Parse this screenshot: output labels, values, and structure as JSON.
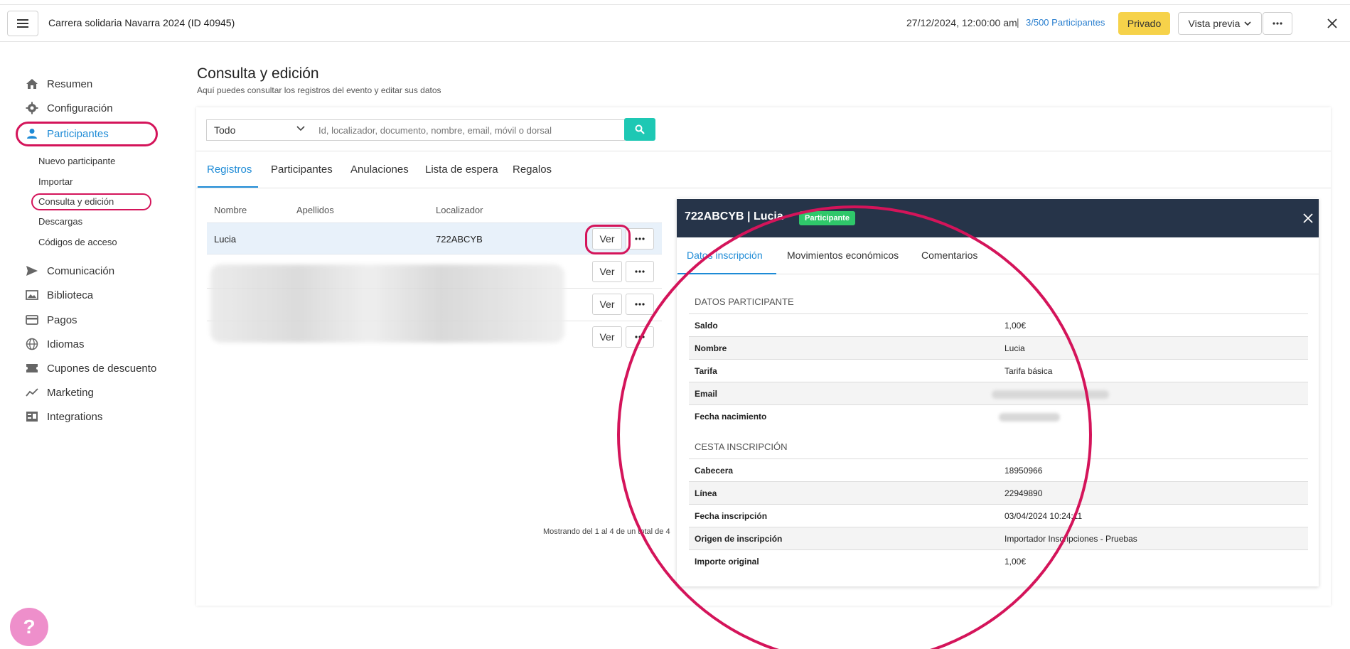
{
  "header": {
    "event_title": "Carrera solidaria Navarra 2024 (ID 40945)",
    "date": "27/12/2024, 12:00:00 am",
    "separator": "|",
    "participants_current": "3/500",
    "participants_label": "Participantes",
    "private_label": "Privado",
    "preview_label": "Vista previa"
  },
  "sidebar": {
    "items": [
      {
        "label": "Resumen",
        "icon": "home-icon"
      },
      {
        "label": "Configuración",
        "icon": "gear-icon"
      },
      {
        "label": "Participantes",
        "icon": "person-icon"
      },
      {
        "label": "Comunicación",
        "icon": "send-icon"
      },
      {
        "label": "Biblioteca",
        "icon": "images-icon"
      },
      {
        "label": "Pagos",
        "icon": "card-icon"
      },
      {
        "label": "Idiomas",
        "icon": "globe-icon"
      },
      {
        "label": "Cupones de descuento",
        "icon": "ticket-icon"
      },
      {
        "label": "Marketing",
        "icon": "trend-icon"
      },
      {
        "label": "Integrations",
        "icon": "integration-icon"
      }
    ],
    "sub_items": [
      "Nuevo participante",
      "Importar",
      "Consulta y edición",
      "Descargas",
      "Códigos de acceso"
    ]
  },
  "page": {
    "title": "Consulta y edición",
    "subtitle": "Aquí puedes consultar los registros del evento y editar sus datos"
  },
  "filter": {
    "select_value": "Todo",
    "search_placeholder": "Id, localizador, documento, nombre, email, móvil o dorsal"
  },
  "tabs": [
    "Registros",
    "Participantes",
    "Anulaciones",
    "Lista de espera",
    "Regalos"
  ],
  "table": {
    "headers": [
      "Nombre",
      "Apellidos",
      "Localizador"
    ],
    "rows": [
      {
        "nombre": "Lucia",
        "apellidos": "",
        "localizador": "722ABCYB"
      }
    ],
    "ver_label": "Ver",
    "showing": "Mostrando del 1 al 4 de un total de 4"
  },
  "detail": {
    "title": "722ABCYB | Lucia",
    "badge": "Participante",
    "badge_color": "#2fc76a",
    "tabs": [
      "Datos inscripción",
      "Movimientos económicos",
      "Comentarios"
    ],
    "section1": "DATOS PARTICIPANTE",
    "participant_rows": [
      {
        "label": "Saldo",
        "value": "1,00€"
      },
      {
        "label": "Nombre",
        "value": "Lucia"
      },
      {
        "label": "Tarifa",
        "value": "Tarifa básica"
      },
      {
        "label": "Email",
        "value": ""
      },
      {
        "label": "Fecha nacimiento",
        "value": ""
      }
    ],
    "section2": "CESTA INSCRIPCIÓN",
    "basket_rows": [
      {
        "label": "Cabecera",
        "value": "18950966"
      },
      {
        "label": "Línea",
        "value": "22949890"
      },
      {
        "label": "Fecha inscripción",
        "value": "03/04/2024 10:24:11"
      },
      {
        "label": "Origen de inscripción",
        "value": "Importador Inscripciones - Pruebas"
      },
      {
        "label": "Importe original",
        "value": "1,00€"
      }
    ]
  },
  "help": {
    "label": "?"
  },
  "colors": {
    "accent": "#1e8bd6",
    "highlight": "#d4145a",
    "search_button": "#1ec8b4",
    "private": "#f6d24a",
    "panel_header": "#263449"
  }
}
